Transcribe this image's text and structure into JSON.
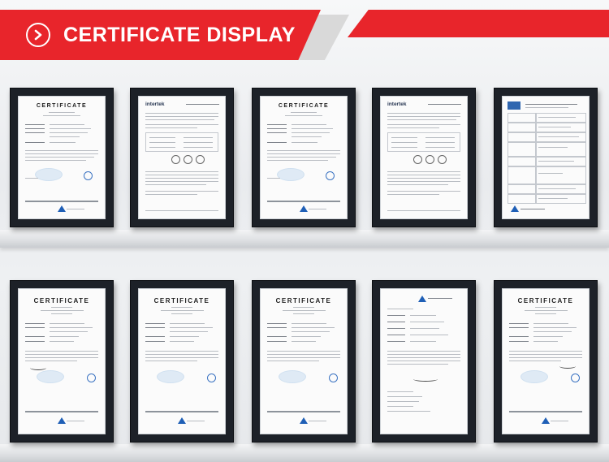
{
  "header": {
    "title": "CERTIFICATE DISPLAY",
    "icon": "chevron-right-icon",
    "accent_color": "#e8252b"
  },
  "certificates_row1": [
    {
      "heading": "CERTIFICATE",
      "logo": ""
    },
    {
      "heading": "",
      "logo": "intertek"
    },
    {
      "heading": "CERTIFICATE",
      "logo": ""
    },
    {
      "heading": "",
      "logo": "intertek"
    },
    {
      "heading": "",
      "logo": ""
    }
  ],
  "certificates_row2": [
    {
      "heading": "CERTIFICATE",
      "logo": ""
    },
    {
      "heading": "CERTIFICATE",
      "logo": ""
    },
    {
      "heading": "CERTIFICATE",
      "logo": ""
    },
    {
      "heading": "",
      "logo": ""
    },
    {
      "heading": "CERTIFICATE",
      "logo": ""
    }
  ]
}
